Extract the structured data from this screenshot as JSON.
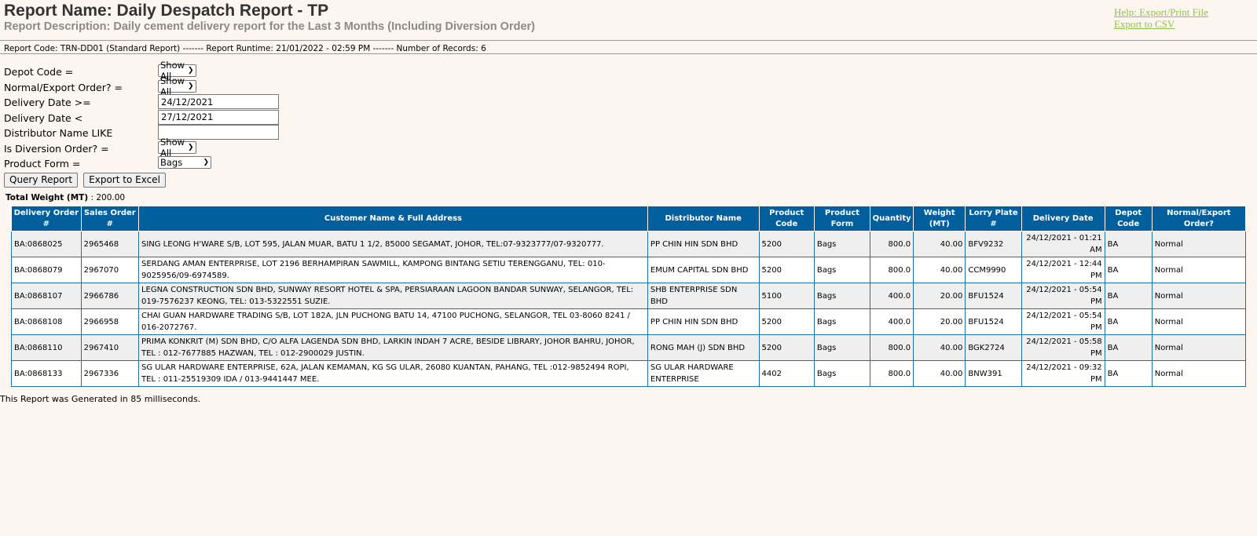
{
  "header": {
    "title": "Report Name: Daily Despatch Report - TP",
    "description": "Report Description: Daily cement delivery report for the Last 3 Months (Including Diversion Order)",
    "help_link": "Help: Export/Print File",
    "csv_link": "Export to CSV",
    "link_color": "#8fbf4f"
  },
  "meta": "Report Code: TRN-DD01 (Standard Report) ------- Report Runtime: 21/01/2022 - 02:59 PM ------- Number of Records: 6",
  "filters": {
    "depot_code_label": "Depot Code =",
    "depot_code_value": "Show All",
    "order_type_label": "Normal/Export Order? =",
    "order_type_value": "Show All",
    "date_from_label": "Delivery Date >=",
    "date_from_value": "24/12/2021",
    "date_to_label": "Delivery Date <",
    "date_to_value": "27/12/2021",
    "distributor_label": "Distributor Name LIKE",
    "distributor_value": "",
    "diversion_label": "Is Diversion Order? =",
    "diversion_value": "Show All",
    "product_form_label": "Product Form =",
    "product_form_value": "Bags"
  },
  "buttons": {
    "query": "Query Report",
    "excel": "Export to Excel"
  },
  "total": {
    "label": "Total Weight (MT)",
    "value": ": 200.00"
  },
  "table": {
    "header_color": "#005f9c",
    "columns": [
      "Delivery Order #",
      "Sales Order #",
      "Customer Name & Full Address",
      "Distributor Name",
      "Product Code",
      "Product Form",
      "Quantity",
      "Weight (MT)",
      "Lorry Plate #",
      "Delivery Date",
      "Depot Code",
      "Normal/Export Order?"
    ],
    "rows": [
      [
        "BA:0868025",
        "2965468",
        "SING LEONG H'WARE S/B, LOT 595, JALAN MUAR, BATU 1 1/2, 85000 SEGAMAT, JOHOR, TEL:07-9323777/07-9320777.",
        "PP CHIN HIN SDN BHD",
        "5200",
        "Bags",
        "800.0",
        "40.00",
        "BFV9232",
        "24/12/2021 - 01:21 AM",
        "BA",
        "Normal"
      ],
      [
        "BA:0868079",
        "2967070",
        "SERDANG AMAN ENTERPRISE, LOT 2196 BERHAMPIRAN SAWMILL, KAMPONG BINTANG SETIU TERENGGANU, TEL: 010-9025956/09-6974589.",
        "EMUM CAPITAL SDN BHD",
        "5200",
        "Bags",
        "800.0",
        "40.00",
        "CCM9990",
        "24/12/2021 - 12:44 PM",
        "BA",
        "Normal"
      ],
      [
        "BA:0868107",
        "2966786",
        "LEGNA CONSTRUCTION SDN BHD, SUNWAY RESORT HOTEL & SPA, PERSIARAAN LAGOON BANDAR SUNWAY, SELANGOR, TEL: 019-7576237 KEONG, TEL: 013-5322551 SUZIE.",
        "SHB ENTERPRISE SDN BHD",
        "5100",
        "Bags",
        "400.0",
        "20.00",
        "BFU1524",
        "24/12/2021 - 05:54 PM",
        "BA",
        "Normal"
      ],
      [
        "BA:0868108",
        "2966958",
        "CHAI GUAN HARDWARE TRADING S/B, LOT 182A, JLN PUCHONG BATU 14, 47100 PUCHONG, SELANGOR, TEL 03-8060 8241 / 016-2072767.",
        "PP CHIN HIN SDN BHD",
        "5200",
        "Bags",
        "400.0",
        "20.00",
        "BFU1524",
        "24/12/2021 - 05:54 PM",
        "BA",
        "Normal"
      ],
      [
        "BA:0868110",
        "2967410",
        "PRIMA KONKRIT (M) SDN BHD, C/O ALFA LAGENDA SDN BHD, LARKIN INDAH 7 ACRE, BESIDE LIBRARY, JOHOR BAHRU, JOHOR, TEL : 012-7677885 HAZWAN, TEL : 012-2900029 JUSTIN.",
        "RONG MAH (J) SDN BHD",
        "5200",
        "Bags",
        "800.0",
        "40.00",
        "BGK2724",
        "24/12/2021 - 05:58 PM",
        "BA",
        "Normal"
      ],
      [
        "BA:0868133",
        "2967336",
        "SG ULAR HARDWARE ENTERPRISE, 62A, JALAN KEMAMAN, KG SG ULAR, 26080 KUANTAN, PAHANG, TEL :012-9852494 ROPI, TEL : 011-25519309 IDA / 013-9441447 MEE.",
        "SG ULAR HARDWARE ENTERPRISE",
        "4402",
        "Bags",
        "800.0",
        "40.00",
        "BNW391",
        "24/12/2021 - 09:32 PM",
        "BA",
        "Normal"
      ]
    ]
  },
  "footer": "This Report was Generated in 85 milliseconds."
}
